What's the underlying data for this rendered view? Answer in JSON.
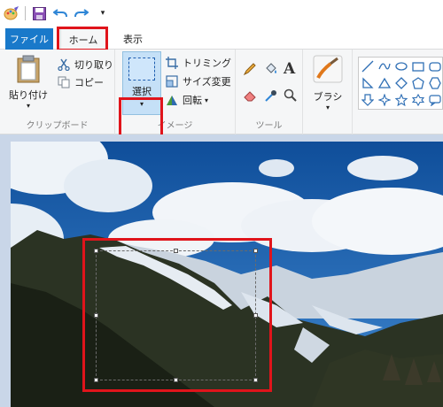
{
  "tabs": {
    "file": "ファイル",
    "home": "ホーム",
    "view": "表示"
  },
  "clipboard": {
    "paste": "貼り付け",
    "cut": "切り取り",
    "copy": "コピー",
    "group_label": "クリップボード"
  },
  "image": {
    "select": "選択",
    "crop": "トリミング",
    "resize": "サイズ変更",
    "rotate": "回転",
    "group_label": "イメージ"
  },
  "tools": {
    "group_label": "ツール"
  },
  "brushes": {
    "label": "ブラシ"
  },
  "colors": {
    "accent": "#1979ca",
    "highlight": "#e0141b",
    "select_fill": "#c5e0f7"
  },
  "icons": {
    "app": "paint-icon",
    "save": "save-icon",
    "undo": "undo-icon",
    "redo": "redo-icon"
  }
}
